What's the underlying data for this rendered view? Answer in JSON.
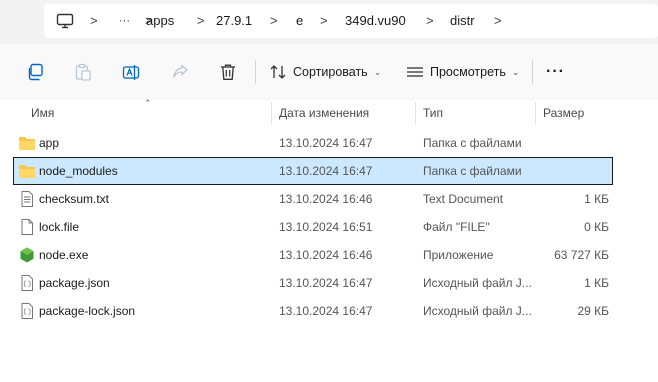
{
  "breadcrumb": {
    "items": [
      "apps",
      "27.9.1",
      "e",
      "349d.vu90",
      "distr"
    ],
    "separator": ">",
    "overflow": "···"
  },
  "toolbar": {
    "sort_label": "Сортировать",
    "view_label": "Просмотреть",
    "more_label": "···"
  },
  "columns": {
    "name": "Имя",
    "date": "Дата изменения",
    "type": "Тип",
    "size": "Размер"
  },
  "files": [
    {
      "name": "app",
      "date": "13.10.2024 16:47",
      "type": "Папка с файлами",
      "size": "",
      "icon": "folder-icon",
      "selected": false
    },
    {
      "name": "node_modules",
      "date": "13.10.2024 16:47",
      "type": "Папка с файлами",
      "size": "",
      "icon": "folder-icon",
      "selected": true
    },
    {
      "name": "checksum.txt",
      "date": "13.10.2024 16:46",
      "type": "Text Document",
      "size": "1 КБ",
      "icon": "text-file-icon",
      "selected": false
    },
    {
      "name": "lock.file",
      "date": "13.10.2024 16:51",
      "type": "Файл \"FILE\"",
      "size": "0 КБ",
      "icon": "blank-file-icon",
      "selected": false
    },
    {
      "name": "node.exe",
      "date": "13.10.2024 16:46",
      "type": "Приложение",
      "size": "63 727 КБ",
      "icon": "nodejs-icon",
      "selected": false
    },
    {
      "name": "package.json",
      "date": "13.10.2024 16:47",
      "type": "Исходный файл J...",
      "size": "1 КБ",
      "icon": "json-file-icon",
      "selected": false
    },
    {
      "name": "package-lock.json",
      "date": "13.10.2024 16:47",
      "type": "Исходный файл J...",
      "size": "29 КБ",
      "icon": "json-file-icon",
      "selected": false
    }
  ],
  "colors": {
    "selection": "#cce8ff",
    "folder": "#f8c64a",
    "accent": "#0067c0"
  }
}
